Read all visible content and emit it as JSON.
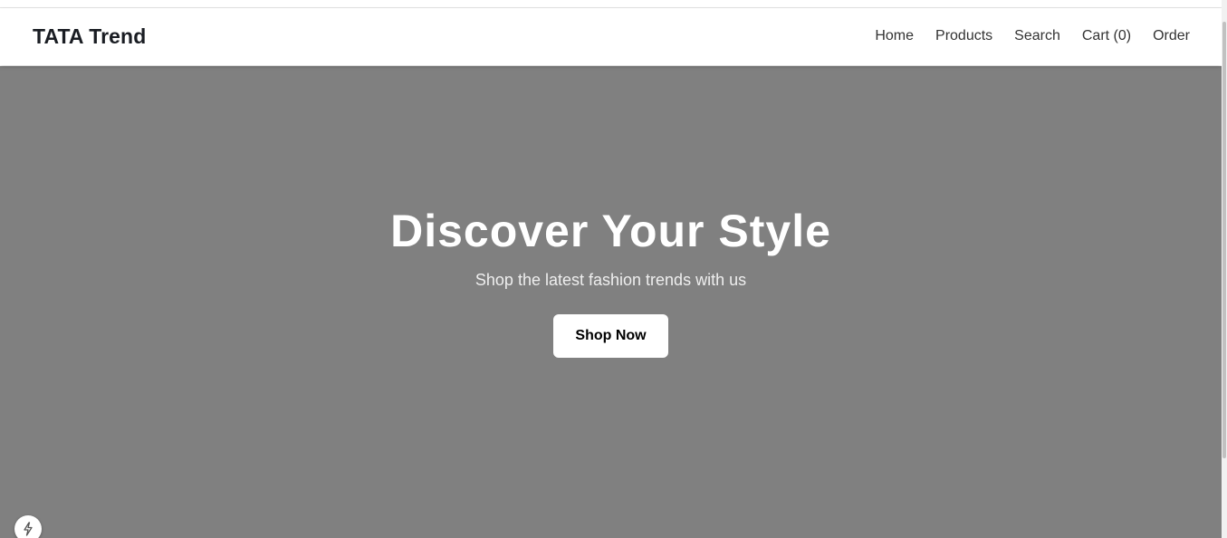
{
  "navbar": {
    "brand": "TATA Trend",
    "links": [
      {
        "label": "Home"
      },
      {
        "label": "Products"
      },
      {
        "label": "Search"
      },
      {
        "label": "Cart (0)"
      },
      {
        "label": "Order"
      }
    ]
  },
  "hero": {
    "title": "Discover Your Style",
    "subtitle": "Shop the latest fashion trends with us",
    "cta_label": "Shop Now",
    "background_color": "#808080"
  },
  "dev_badge": {
    "icon": "lightning-icon"
  }
}
